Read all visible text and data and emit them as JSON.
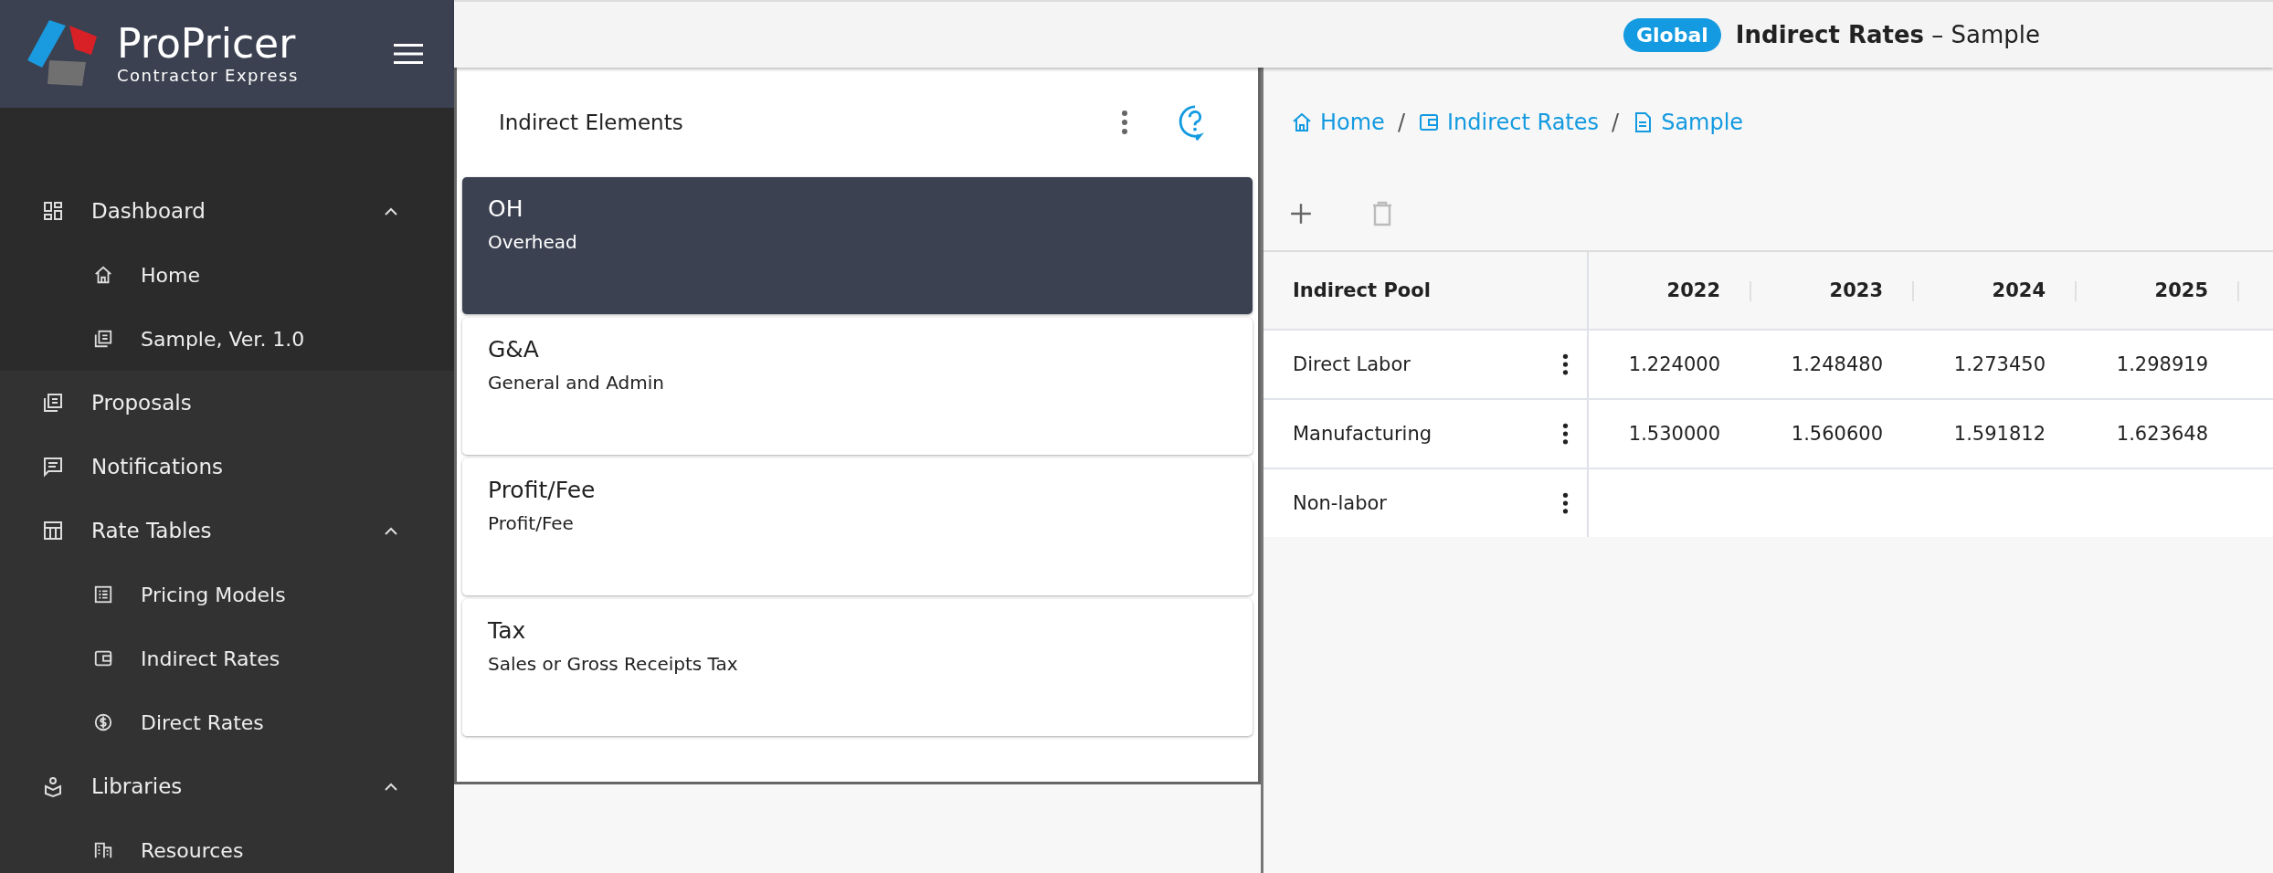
{
  "brand": {
    "name": "ProPricer",
    "tagline": "Contractor Express"
  },
  "sidebar": {
    "items": [
      {
        "label": "Dashboard",
        "expanded": true,
        "children": [
          {
            "label": "Home"
          },
          {
            "label": "Sample, Ver. 1.0"
          }
        ]
      },
      {
        "label": "Proposals"
      },
      {
        "label": "Notifications"
      },
      {
        "label": "Rate Tables",
        "expanded": true,
        "children": [
          {
            "label": "Pricing Models"
          },
          {
            "label": "Indirect Rates"
          },
          {
            "label": "Direct Rates"
          }
        ]
      },
      {
        "label": "Libraries",
        "expanded": true,
        "children": [
          {
            "label": "Resources"
          }
        ]
      }
    ]
  },
  "topbar": {
    "badge": "Global",
    "title": "**Indirect Rates** – Sample"
  },
  "elements_panel": {
    "title": "Indirect Elements",
    "items": [
      {
        "code": "OH",
        "name": "Overhead",
        "selected": true
      },
      {
        "code": "G&A",
        "name": "General and Admin",
        "selected": false
      },
      {
        "code": "Profit/Fee",
        "name": "Profit/Fee",
        "selected": false
      },
      {
        "code": "Tax",
        "name": "Sales or Gross Receipts Tax",
        "selected": false
      }
    ]
  },
  "breadcrumb": {
    "links": [
      "Home",
      "Indirect Rates",
      "Sample"
    ],
    "separators": [
      "/",
      "/"
    ]
  },
  "toolbar": {
    "add_disabled": false,
    "delete_disabled": true
  },
  "table": {
    "columns": [
      "Indirect Pool",
      "2022",
      "2023",
      "2024",
      "2025"
    ],
    "rows": [
      {
        "name": "Direct Labor",
        "values": [
          "1.224000",
          "1.248480",
          "1.273450",
          "1.298919"
        ]
      },
      {
        "name": "Manufacturing",
        "values": [
          "1.530000",
          "1.560600",
          "1.591812",
          "1.623648"
        ]
      },
      {
        "name": "Non-labor",
        "values": []
      }
    ]
  }
}
